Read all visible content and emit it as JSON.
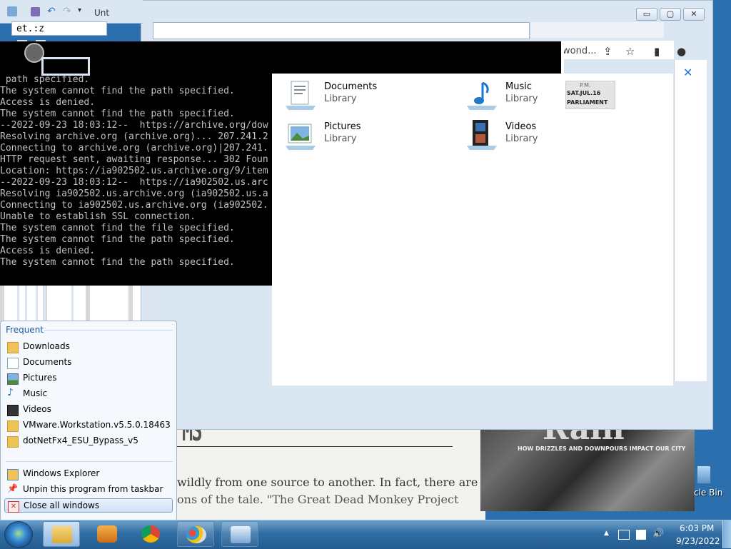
{
  "notepad": {
    "title_partial": "Unt",
    "field_text": "et.:z"
  },
  "browser": {
    "toolbar_text": "wond...",
    "minimize_label": "▭",
    "maximize_label": "▢",
    "close_label": "✕",
    "close_x": "✕"
  },
  "console": {
    "text": " path specified.\nThe system cannot find the path specified.\nAccess is denied.\nThe system cannot find the path specified.\n--2022-09-23 18:03:12--  https://archive.org/dow\nResolving archive.org (archive.org)... 207.241.2\nConnecting to archive.org (archive.org)|207.241.\nHTTP request sent, awaiting response... 302 Foun\nLocation: https://ia902502.us.archive.org/9/item\n--2022-09-23 18:03:12--  https://ia902502.us.arc\nResolving ia902502.us.archive.org (ia902502.us.a\nConnecting to ia902502.us.archive.org (ia902502.\nUnable to establish SSL connection.\nThe system cannot find the file specified.\nThe system cannot find the path specified.\nAccess is denied.\nThe system cannot find the path specified."
  },
  "libraries": [
    {
      "name": "Documents",
      "type": "Library",
      "icon": "documents-library-icon"
    },
    {
      "name": "Music",
      "type": "Library",
      "icon": "music-library-icon"
    },
    {
      "name": "Pictures",
      "type": "Library",
      "icon": "pictures-library-icon"
    },
    {
      "name": "Videos",
      "type": "Library",
      "icon": "videos-library-icon"
    }
  ],
  "stamp": {
    "top": "P.M.",
    "line1": "SAT.JUL.16",
    "line2": "PARLIAMENT"
  },
  "newspaper": {
    "heading": "MS",
    "line1": "wildly from one source to another. In fact, there are",
    "line2": "ons of the tale. \"The Great Dead Monkey Project",
    "photo_title": "Rain",
    "photo_subtitle": "HOW DRIZZLES AND DOWNPOURS IMPACT OUR CITY"
  },
  "desktop": {
    "recycle_label": "cle Bin"
  },
  "jumplist": {
    "header": "Frequent",
    "frequent": [
      {
        "label": "Downloads",
        "icon": "folder-icon"
      },
      {
        "label": "Documents",
        "icon": "document-icon"
      },
      {
        "label": "Pictures",
        "icon": "picture-icon"
      },
      {
        "label": "Music",
        "icon": "music-note-icon"
      },
      {
        "label": "Videos",
        "icon": "video-icon"
      },
      {
        "label": "VMware.Workstation.v5.5.0.18463",
        "icon": "folder-icon"
      },
      {
        "label": "dotNetFx4_ESU_Bypass_v5",
        "icon": "folder-icon"
      }
    ],
    "tasks": [
      {
        "label": "Windows Explorer",
        "icon": "explorer-icon"
      },
      {
        "label": "Unpin this program from taskbar",
        "icon": "unpin-icon"
      },
      {
        "label": "Close all windows",
        "icon": "close-window-icon"
      }
    ]
  },
  "taskbar": {
    "time": "6:03 PM",
    "date": "9/23/2022",
    "tray_arrow": "▲",
    "volume": "🔊"
  },
  "colors": {
    "accent": "#1e5aa8",
    "taskbar": "#2f6da4",
    "console_bg": "#000000",
    "console_fg": "#c0c0c0"
  }
}
